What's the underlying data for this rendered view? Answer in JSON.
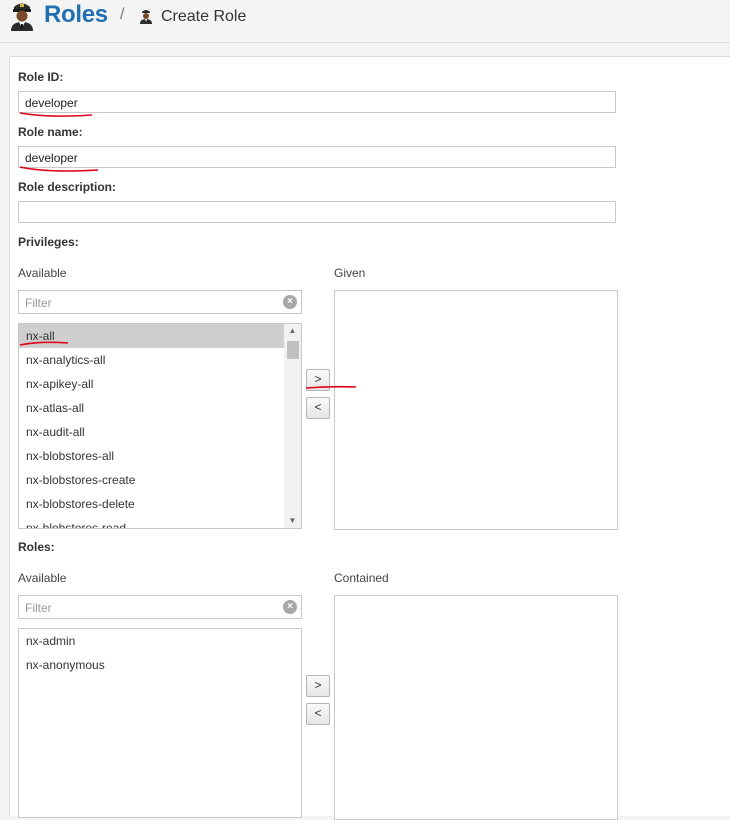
{
  "header": {
    "title": "Roles",
    "separator": "/",
    "subtitle": "Create Role"
  },
  "form": {
    "role_id": {
      "label": "Role ID:",
      "value": "developer"
    },
    "role_name": {
      "label": "Role name:",
      "value": "developer"
    },
    "role_description": {
      "label": "Role description:",
      "value": ""
    }
  },
  "privileges": {
    "label": "Privileges:",
    "available_label": "Available",
    "given_label": "Given",
    "filter_placeholder": "Filter",
    "items": [
      "nx-all",
      "nx-analytics-all",
      "nx-apikey-all",
      "nx-atlas-all",
      "nx-audit-all",
      "nx-blobstores-all",
      "nx-blobstores-create",
      "nx-blobstores-delete",
      "nx-blobstores-read"
    ],
    "selected": "nx-all",
    "add_label": ">",
    "remove_label": "<"
  },
  "roles": {
    "label": "Roles:",
    "available_label": "Available",
    "contained_label": "Contained",
    "filter_placeholder": "Filter",
    "items": [
      "nx-admin",
      "nx-anonymous"
    ],
    "add_label": ">",
    "remove_label": "<"
  },
  "colors": {
    "title_blue": "#1f6fb2",
    "selection_gray": "#cfcfcf",
    "annotation_red": "#e0001b"
  }
}
